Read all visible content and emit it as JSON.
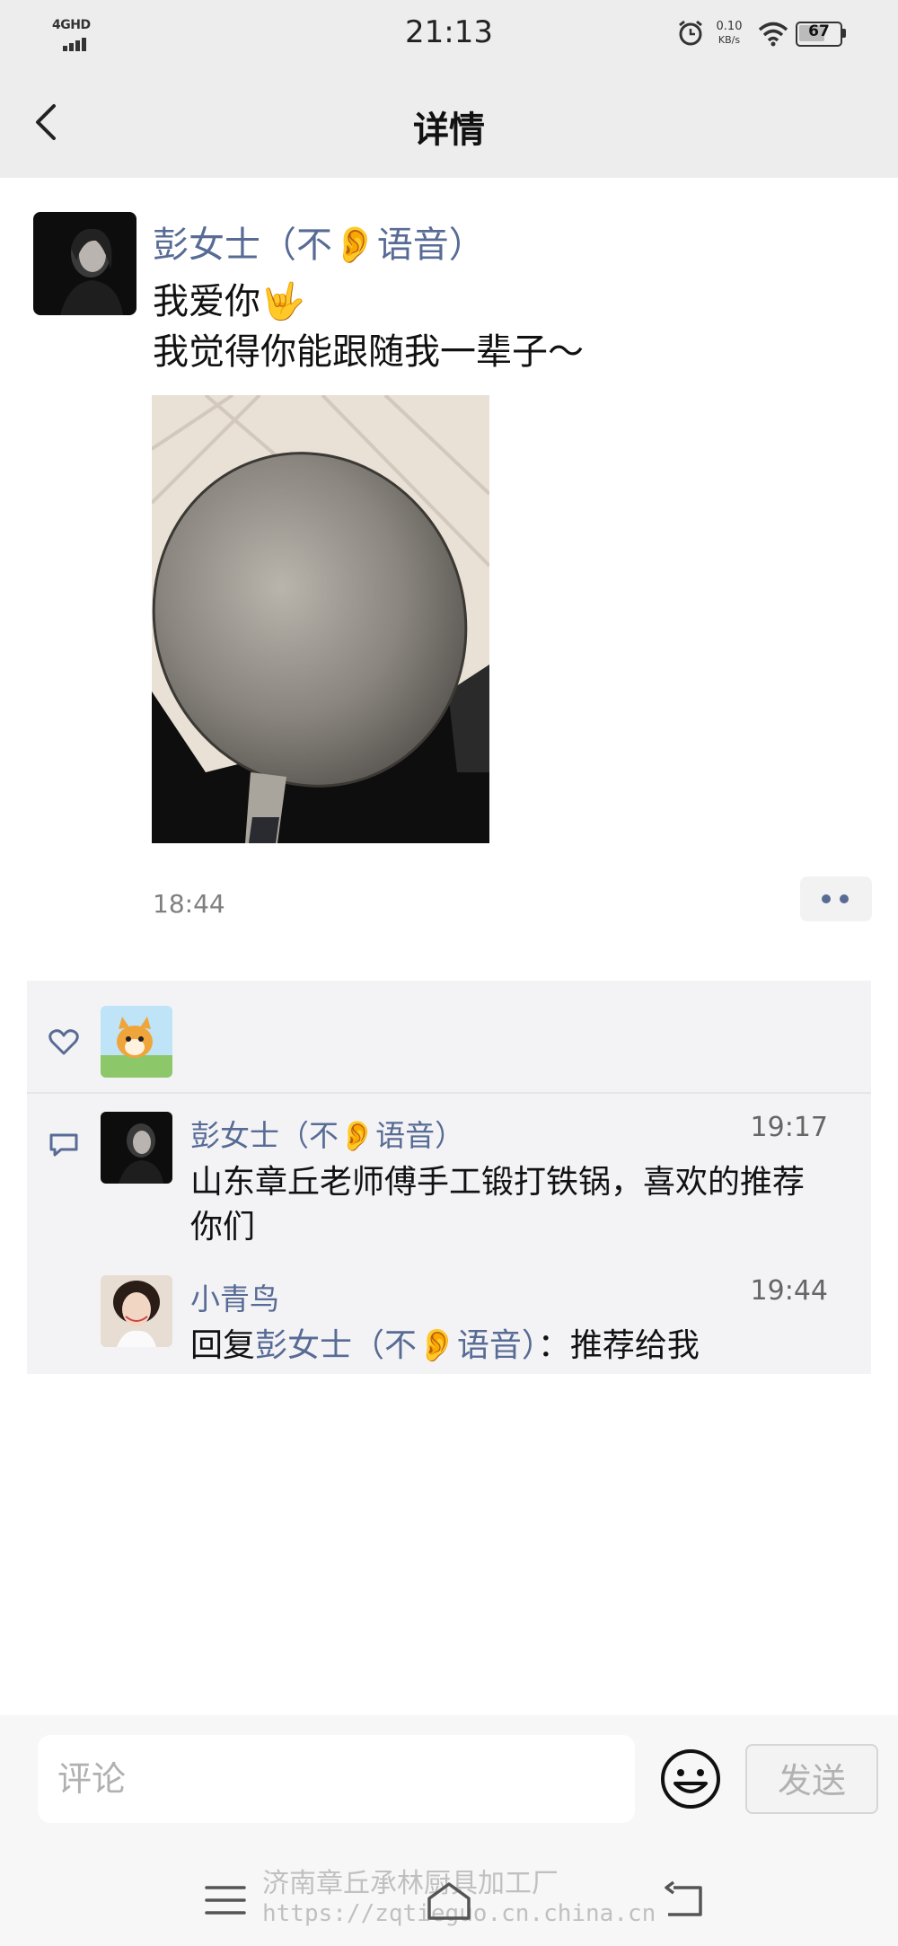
{
  "status_bar": {
    "network_label": "4GHD",
    "time": "21:13",
    "net_speed_value": "0.10",
    "net_speed_unit": "KB/s",
    "battery": "67"
  },
  "nav": {
    "title": "详情",
    "back_icon": "chevron-left-icon"
  },
  "post": {
    "author": "彭女士（不👂语音）",
    "text": "我爱你🤟\n我觉得你能跟随我一辈子～",
    "time": "18:44",
    "image_description_icon": "wok-photo"
  },
  "interactions": {
    "like_icon": "heart-outline-icon",
    "comment_icon": "comment-bubble-icon",
    "comments": [
      {
        "name": "彭女士（不👂语音）",
        "time": "19:17",
        "text": "山东章丘老师傅手工锻打铁锅，喜欢的推荐你们"
      },
      {
        "name": "小青鸟",
        "time": "19:44",
        "reply_prefix": "回复",
        "reply_to": "彭女士（不👂语音）",
        "reply_text": "：推荐给我"
      }
    ]
  },
  "input_bar": {
    "placeholder": "评论",
    "send_label": "发送"
  },
  "watermark": {
    "line1": "济南章丘承林厨具加工厂",
    "line2": "https://zqtieguo.cn.china.cn"
  },
  "colors": {
    "link_blue": "#576b95",
    "bar_gray": "#ededed",
    "comment_bg": "#f3f3f5"
  }
}
